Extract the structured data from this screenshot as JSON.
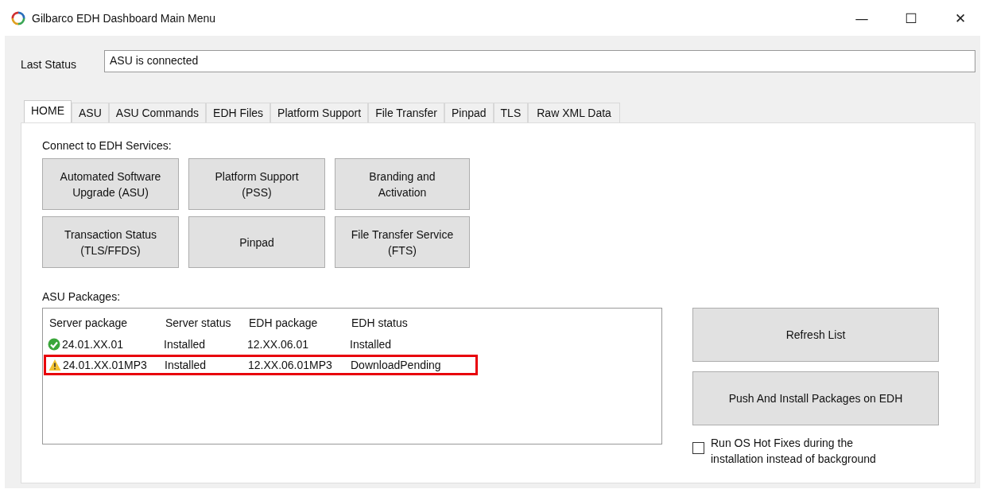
{
  "window": {
    "title": "Gilbarco EDH Dashboard Main Menu",
    "controls": [
      "—",
      "☐",
      "✕"
    ]
  },
  "last_status": {
    "label": "Last Status",
    "value": "ASU is connected"
  },
  "tabs": [
    {
      "label": "HOME",
      "selected": true
    },
    {
      "label": "ASU",
      "selected": false
    },
    {
      "label": "ASU Commands",
      "selected": false
    },
    {
      "label": "EDH Files",
      "selected": false
    },
    {
      "label": "Platform Support",
      "selected": false
    },
    {
      "label": "File Transfer",
      "selected": false
    },
    {
      "label": "Pinpad",
      "selected": false
    },
    {
      "label": "TLS",
      "selected": false
    },
    {
      "label": "Raw XML Data",
      "selected": false
    }
  ],
  "services": {
    "label": "Connect to EDH Services:",
    "buttons": [
      [
        "Automated Software",
        "Upgrade (ASU)"
      ],
      [
        "Platform Support",
        "(PSS)"
      ],
      [
        "Branding and",
        "Activation"
      ],
      [
        "Transaction Status",
        "(TLS/FFDS)"
      ],
      [
        "Pinpad"
      ],
      [
        "File Transfer Service",
        "(FTS)"
      ]
    ]
  },
  "packages": {
    "label": "ASU Packages:",
    "columns": [
      "Server package",
      "Server status",
      "EDH package",
      "EDH status"
    ],
    "rows": [
      {
        "kind": "ok",
        "highlighted": false,
        "cells": [
          "24.01.XX.01",
          "Installed",
          "12.XX.06.01",
          "Installed"
        ]
      },
      {
        "kind": "warning",
        "highlighted": true,
        "cells": [
          "24.01.XX.01MP3",
          "Installed",
          "12.XX.06.01MP3",
          "DownloadPending"
        ]
      }
    ]
  },
  "actions": [
    "Refresh List",
    "Push And Install Packages on EDH"
  ],
  "hotfix": {
    "label": "Run OS Hot Fixes during the installation instead of background",
    "checked": false
  }
}
